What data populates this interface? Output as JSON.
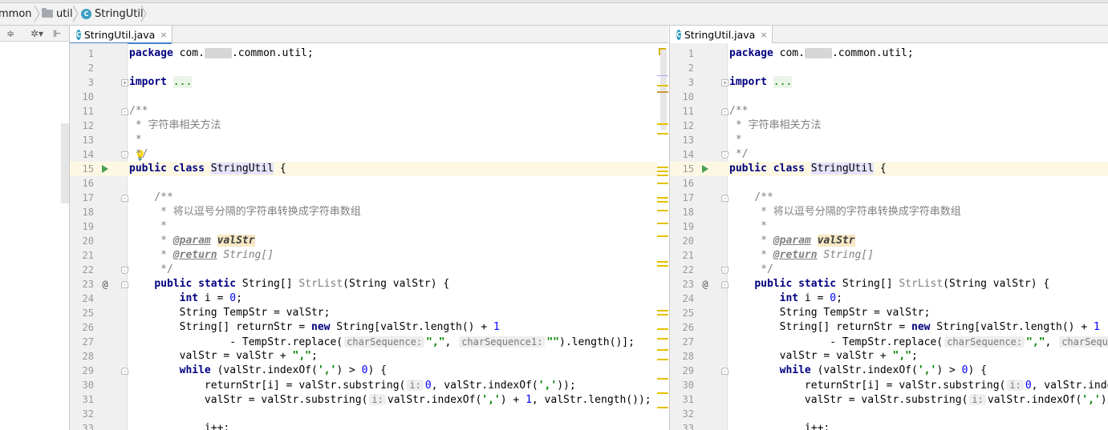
{
  "breadcrumb": {
    "items": [
      {
        "label": "mmon",
        "icon": "none"
      },
      {
        "label": "util",
        "icon": "folder-icon"
      },
      {
        "label": "StringUtil",
        "icon": "class-icon"
      }
    ]
  },
  "toolbar": {
    "collapse_glyph": "≑",
    "settings_glyph": "✲▾",
    "pin_glyph": "⊩"
  },
  "left_tab": {
    "label": "StringUtil.java",
    "close": "×",
    "icon_letter": "C"
  },
  "right_tab": {
    "label": "StringUtil.java",
    "close": "×",
    "icon_letter": "C"
  },
  "colors": {
    "keyword": "#000080",
    "string": "#008000",
    "number": "#0000ff",
    "comment": "#808080",
    "tab_accent": "#4083c9",
    "caret_line": "#fcf8e3"
  },
  "gutter": {
    "line_numbers": [
      "1",
      "2",
      "3",
      "10",
      "11",
      "12",
      "13",
      "14",
      "15",
      "16",
      "17",
      "18",
      "19",
      "20",
      "21",
      "22",
      "23",
      "24",
      "25",
      "26",
      "27",
      "28",
      "29",
      "30",
      "31",
      "32",
      "33"
    ],
    "override_marker": "@",
    "fold_expand": "+",
    "fold_collapse": "-"
  },
  "code": {
    "package_kw": "package",
    "package_pre": " com.",
    "package_post": ".common.util;",
    "import_kw": "import",
    "import_fold": "...",
    "doc_open": "/**",
    "class_doc": " * 字符串相关方法",
    "doc_star": " *",
    "doc_close": " */",
    "public_kw": "public",
    "class_kw": "class",
    "class_name": "StringUtil",
    "brace_open": " {",
    "method_doc_open": "    /**",
    "method_doc": "     * 将以逗号分隔的字符串转换成字符串数组",
    "method_doc_star": "     *",
    "method_doc_star_pre": "     * ",
    "param_tag": "@param",
    "param_name": "valStr",
    "return_tag": "@return",
    "return_type": "String[]",
    "method_doc_close": "     */",
    "static_kw": "static",
    "method_ret": "String[]",
    "method_name": "StrList",
    "method_params": "(String valStr) {",
    "int_kw": "int",
    "l24_rest": " i = ",
    "zero": "0",
    "semicolon": ";",
    "l25": "String TempStr = valStr;",
    "l26_pre": "String[] returnStr = ",
    "new_kw": "new",
    "l26_mid": " String[valStr.length() + ",
    "one": "1",
    "l27_pre": "- TempStr.replace(",
    "hint_charseq": "charSequence:",
    "str_comma": "\",\"",
    "comma_sep": ",",
    "hint_charseq1": "charSequence1:",
    "str_empty": "\"\"",
    "l27_post": ").length()];",
    "l28_pre": "valStr = valStr + ",
    "while_kw": "while",
    "l29_pre": " (valStr.indexOf(",
    "char_comma": "','",
    "l29_post": ") > ",
    "l29_end": ") {",
    "l30_pre": "returnStr[i] = valStr.substring(",
    "hint_i": "i:",
    "l30_mid": ", valStr.indexOf(",
    "l30_post": "));",
    "l31_pre": "valStr = valStr.substring(",
    "l31_mid": "valStr.indexOf(",
    "l31_plus": ") + ",
    "l31_post": ", valStr.length());",
    "l33": "i++;"
  }
}
